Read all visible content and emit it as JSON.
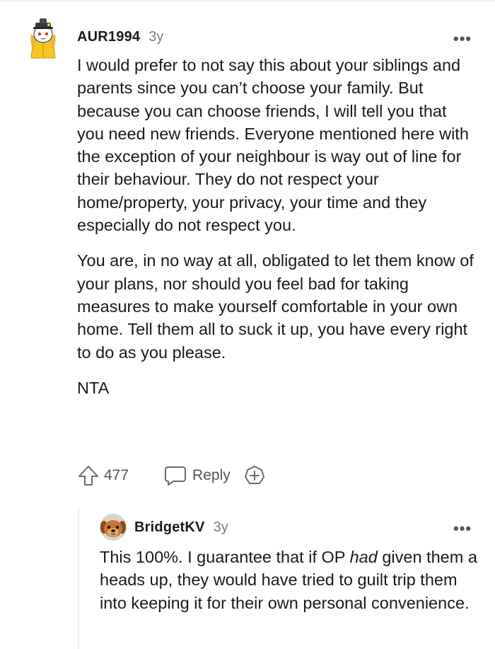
{
  "comment": {
    "username": "AUR1994",
    "age": "3y",
    "paragraphs": [
      "I would prefer to not say this about your siblings and parents since you can’t choose your family. But because you can choose friends, I will tell you that you need new friends. Everyone mentioned here with the exception of your neighbour is way out of line for their behaviour. They do not respect your home/property, your privacy, your time and they especially do not respect you.",
      "You are, in no way at all, obligated to let them know of your plans, nor should you feel bad for taking measures to make yourself comfortable in your own home. Tell them all to suck it up, you have every right to do as you please.",
      "NTA"
    ],
    "more_label": "•••",
    "upvote_icon": "upvote-arrow-icon",
    "vote_count": "477",
    "reply_icon": "speech-bubble-icon",
    "reply_label": "Reply",
    "award_icon": "plus-circle-icon"
  },
  "reply": {
    "username": "BridgetKV",
    "age": "3y",
    "more_label": "•••",
    "text_before": "This 100%. I guarantee that if OP ",
    "text_emphasis": "had",
    "text_after": " given them a heads up, they would have tried to guilt trip them into keeping it for their own personal convenience."
  },
  "colors": {
    "text": "#1a1a1b",
    "meta": "#787c7e",
    "icon": "#555555",
    "thread_line": "#edeff1"
  }
}
